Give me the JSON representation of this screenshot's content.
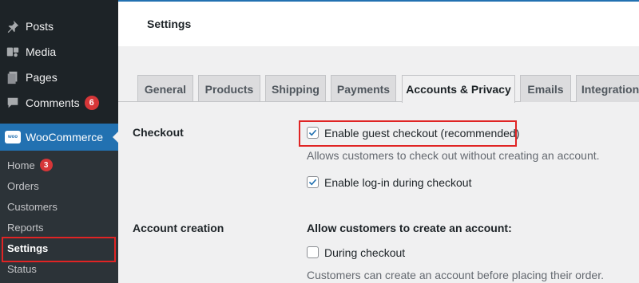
{
  "sidebar": {
    "items": [
      {
        "label": "Posts",
        "icon": "pin-icon"
      },
      {
        "label": "Media",
        "icon": "media-icon"
      },
      {
        "label": "Pages",
        "icon": "pages-icon"
      },
      {
        "label": "Comments",
        "icon": "comment-icon",
        "badge": "6"
      }
    ],
    "woocommerce": {
      "label": "WooCommerce",
      "logo": "woo"
    },
    "submenu": [
      {
        "label": "Home",
        "badge": "3"
      },
      {
        "label": "Orders"
      },
      {
        "label": "Customers"
      },
      {
        "label": "Reports"
      },
      {
        "label": "Settings",
        "active": true
      },
      {
        "label": "Status"
      }
    ]
  },
  "header": {
    "title": "Settings"
  },
  "tabs": [
    {
      "label": "General"
    },
    {
      "label": "Products"
    },
    {
      "label": "Shipping"
    },
    {
      "label": "Payments"
    },
    {
      "label": "Accounts & Privacy",
      "active": true
    },
    {
      "label": "Emails"
    },
    {
      "label": "Integration"
    }
  ],
  "form": {
    "checkout": {
      "label": "Checkout",
      "guest_checkout": {
        "label": "Enable guest checkout (recommended)",
        "checked": true
      },
      "guest_checkout_desc": "Allows customers to check out without creating an account.",
      "login_checkout": {
        "label": "Enable log-in during checkout",
        "checked": true
      }
    },
    "account_creation": {
      "label": "Account creation",
      "heading": "Allow customers to create an account:",
      "during_checkout": {
        "label": "During checkout",
        "checked": false
      },
      "during_checkout_desc": "Customers can create an account before placing their order."
    }
  },
  "colors": {
    "sidebar": "#1d2327",
    "submenu": "#2c3338",
    "accent": "#2271b1",
    "badge": "#d63638",
    "highlight": "#e02424"
  }
}
